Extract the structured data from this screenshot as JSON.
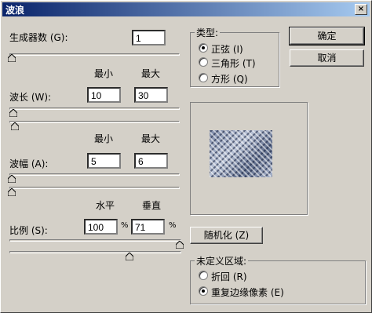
{
  "dialog": {
    "title": "波浪",
    "close_glyph": "×"
  },
  "generators": {
    "label": "生成器数 (G):",
    "value": "1"
  },
  "wavelength": {
    "label": "波长 (W):",
    "min_header": "最小",
    "max_header": "最大",
    "min_value": "10",
    "max_value": "30",
    "min_slider_level": 0.01,
    "max_slider_level": 0.03
  },
  "amplitude": {
    "label": "波幅 (A):",
    "min_header": "最小",
    "max_header": "最大",
    "min_value": "5",
    "max_value": "6",
    "min_slider_level": 0.005,
    "max_slider_level": 0.006
  },
  "scale": {
    "label": "比例 (S):",
    "h_header": "水平",
    "v_header": "垂直",
    "h_value": "100",
    "v_value": "71",
    "percent": "%",
    "h_slider_level": 1.0,
    "v_slider_level": 0.71
  },
  "type_group": {
    "label": "类型:",
    "options": [
      "正弦 (I)",
      "三角形 (T)",
      "方形 (Q)"
    ],
    "selected": 0
  },
  "buttons": {
    "ok": "确定",
    "cancel": "取消",
    "randomize": "随机化 (Z)"
  },
  "undefined_area": {
    "label": "未定义区域:",
    "options": [
      "折回 (R)",
      "重复边缘像素 (E)"
    ],
    "selected": 1
  },
  "colors": {
    "titlebar_start": "#0a246a",
    "titlebar_end": "#a6caf0",
    "face": "#d4d0c8"
  }
}
